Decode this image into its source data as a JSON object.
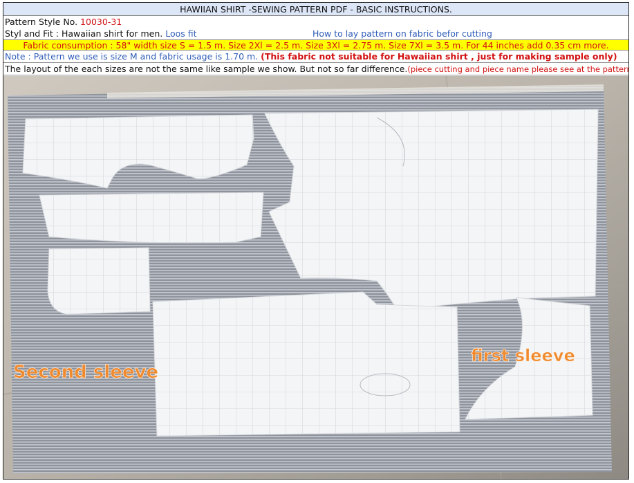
{
  "header": {
    "title": "HAWIIAN SHIRT  -SEWING PATTERN PDF -  BASIC INSTRUCTIONS."
  },
  "pattern_style": {
    "label": "Pattern  Style   No. ",
    "number": "10030-31"
  },
  "style_fit": {
    "label": "Styl and Fit :  Hawaiian shirt for men.",
    "fit": " Loos fit",
    "lay_note": "How to lay pattern on fabric befor cutting"
  },
  "fabric_consumption": "Fabric consumption : 58\" width size  S = 1.5 m.  Size 2Xl = 2.5 m.  Size 3Xl = 2.75 m. Size 7Xl = 3.5 m.    For 44 inches add 0.35 cm more.",
  "note": {
    "text": "Note : Pattern we use is size M  and fabric usage is 1.70 m. ",
    "warning": "(This fabric not suitable for Hawaiian shirt , just for making sample only)"
  },
  "layout_note": {
    "text": "The layout of the each sizes are not the same like sample we show. But not so far difference.",
    "detail": "(piece cutting and piece name  please see at the pattern preview )"
  },
  "photo": {
    "label_second_sleeve": "Second sleeve",
    "label_first_sleeve": "first sleeve",
    "label_color": "#f08a2e"
  },
  "colors": {
    "title_bg": "#dce6f7",
    "highlight_bg": "#ffff00",
    "red_text": "#d21212",
    "blue_text": "#2f5db8"
  }
}
